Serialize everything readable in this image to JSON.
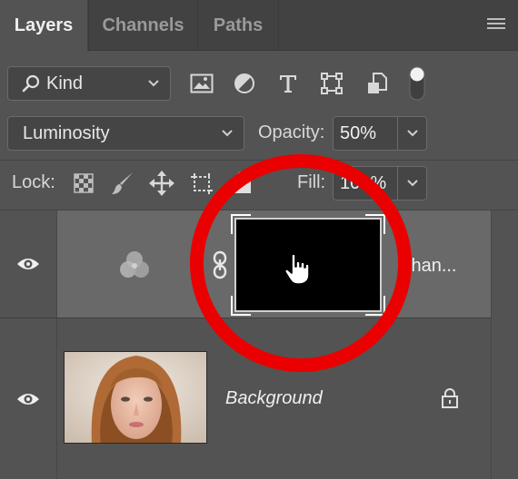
{
  "tabs": [
    {
      "label": "Layers",
      "active": true
    },
    {
      "label": "Channels",
      "active": false
    },
    {
      "label": "Paths",
      "active": false
    }
  ],
  "filter": {
    "kind_label": "Kind",
    "icons": [
      "image-filter-icon",
      "adjustment-filter-icon",
      "type-filter-icon",
      "shape-filter-icon",
      "smart-object-filter-icon",
      "filter-toggle-icon"
    ]
  },
  "blend": {
    "mode": "Luminosity",
    "opacity_label": "Opacity:",
    "opacity_value": "50%"
  },
  "lock": {
    "label": "Lock:",
    "fill_label": "Fill:",
    "fill_value": "100%",
    "icons": [
      "lock-transparent-pixels-icon",
      "lock-image-pixels-icon",
      "lock-position-icon",
      "lock-artboards-icon",
      "lock-all-icon"
    ]
  },
  "layers": [
    {
      "name": "Chan...",
      "type": "channel-mixer-adjustment",
      "visible": true,
      "selected": true,
      "mask": "black"
    },
    {
      "name": "Background",
      "type": "image",
      "visible": true,
      "locked": true
    }
  ],
  "colors": {
    "panel": "#535353",
    "tab_bar": "#424242",
    "selected_row": "#696969",
    "highlight_circle": "#ea0000"
  }
}
